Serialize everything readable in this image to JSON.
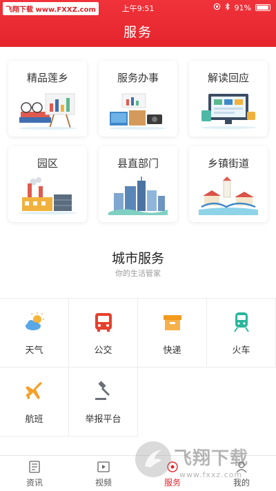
{
  "status_bar": {
    "watermark": "飞翔下载 www.FXXZ.com",
    "time": "上午9:51",
    "battery": "91%"
  },
  "header": {
    "title": "服务"
  },
  "categories": [
    {
      "label": "精品莲乡",
      "icon": "reading-glasses-chart-illustration"
    },
    {
      "label": "服务办事",
      "icon": "office-desk-illustration"
    },
    {
      "label": "解读回应",
      "icon": "computer-screen-illustration"
    },
    {
      "label": "园区",
      "icon": "factory-illustration"
    },
    {
      "label": "县直部门",
      "icon": "city-buildings-illustration"
    },
    {
      "label": "乡镇街道",
      "icon": "town-bridge-illustration"
    }
  ],
  "city_services": {
    "title": "城市服务",
    "subtitle": "你的生活管家",
    "items": [
      {
        "label": "天气",
        "icon": "weather-icon",
        "color": "#5aa7e6"
      },
      {
        "label": "公交",
        "icon": "bus-icon",
        "color": "#e5402d"
      },
      {
        "label": "快递",
        "icon": "parcel-box-icon",
        "color": "#f39a1e"
      },
      {
        "label": "火车",
        "icon": "train-icon",
        "color": "#2bb69b"
      },
      {
        "label": "航班",
        "icon": "airplane-icon",
        "color": "#f4a12a"
      },
      {
        "label": "举报平台",
        "icon": "gavel-icon",
        "color": "#6b6f78"
      }
    ]
  },
  "tabbar": {
    "items": [
      {
        "label": "资讯",
        "icon": "news-icon"
      },
      {
        "label": "视频",
        "icon": "video-icon"
      },
      {
        "label": "服务",
        "icon": "service-icon",
        "active": true
      },
      {
        "label": "我的",
        "icon": "profile-icon"
      }
    ]
  },
  "watermark_bottom": {
    "title": "飞翔下载",
    "url": "www.fxxz.com"
  },
  "colors": {
    "brand": "#e5252d",
    "divider": "#ececec"
  }
}
